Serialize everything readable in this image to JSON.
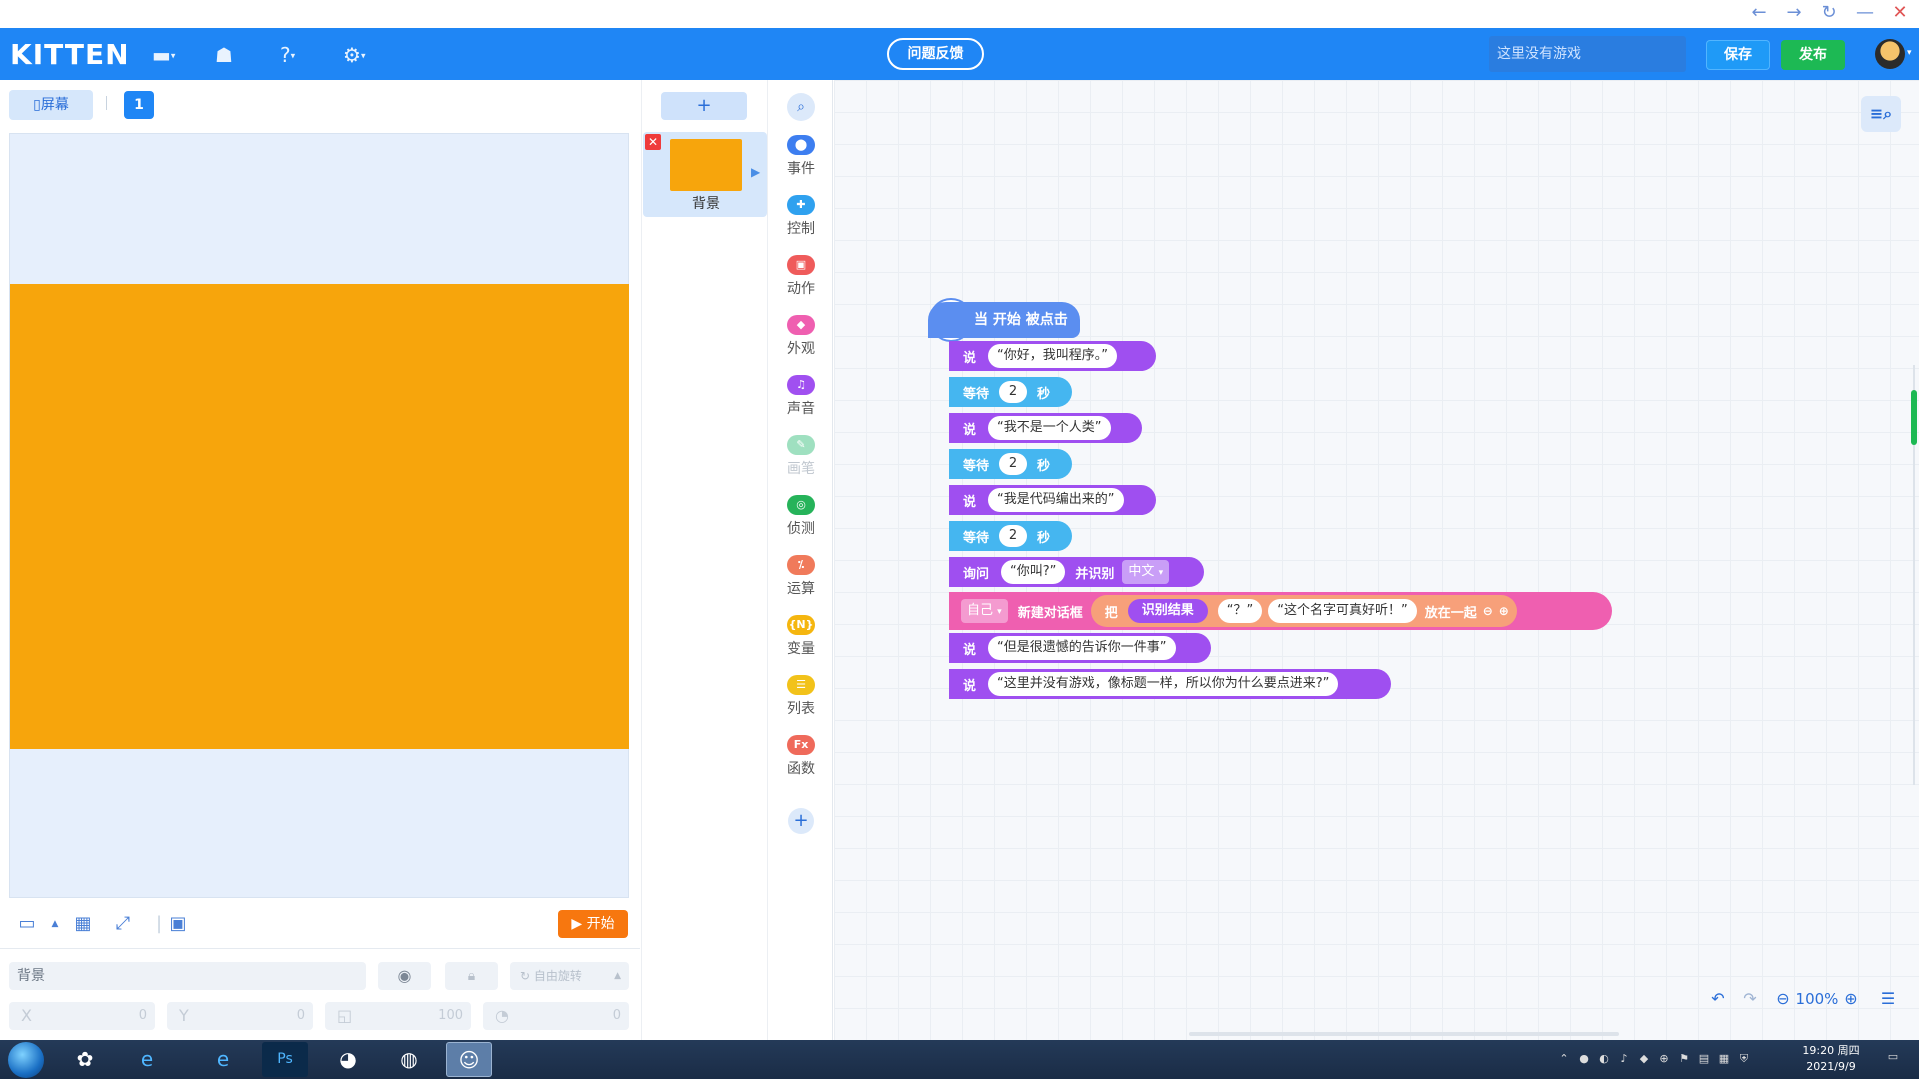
{
  "window": {
    "back_icon": "arrow-left-icon",
    "forward_icon": "arrow-right-icon",
    "refresh_icon": "refresh-icon",
    "min_icon": "minimize-icon",
    "close_icon": "close-icon"
  },
  "header": {
    "logo": "KITTEN",
    "feedback_label": "问题反馈",
    "game_title_placeholder": "这里没有游戏",
    "save_label": "保存",
    "publish_label": "发布",
    "accent": "#1f86f5"
  },
  "stage": {
    "screen_tab": "▯屏幕",
    "scene_number": "1",
    "start_label": "▶ 开始",
    "background_color": "#f7a50c"
  },
  "properties": {
    "name_value": "背景",
    "rotate_label": "自由旋转",
    "x_label": "X",
    "x_value": "0",
    "y_label": "Y",
    "y_value": "0",
    "size_value": "100",
    "direction_value": "0"
  },
  "sprites": {
    "add_label": "+",
    "items": [
      {
        "name": "背景",
        "color": "#f7a50c"
      }
    ]
  },
  "categories": [
    {
      "label": "事件",
      "icon": "event-icon",
      "color": "#3d7ef0"
    },
    {
      "label": "控制",
      "icon": "control-icon",
      "color": "#2fa1ef"
    },
    {
      "label": "动作",
      "icon": "motion-icon",
      "color": "#ef5b5b"
    },
    {
      "label": "外观",
      "icon": "looks-icon",
      "color": "#ef5fb0"
    },
    {
      "label": "声音",
      "icon": "sound-icon",
      "color": "#a050f0"
    },
    {
      "label": "画笔",
      "icon": "pen-icon",
      "color": "#9fe0c0"
    },
    {
      "label": "侦测",
      "icon": "sensing-icon",
      "color": "#26b35a"
    },
    {
      "label": "运算",
      "icon": "operator-icon",
      "color": "#f07a5b"
    },
    {
      "label": "变量",
      "icon": "variable-icon",
      "color": "#f5b60f"
    },
    {
      "label": "列表",
      "icon": "list-icon",
      "color": "#f2c21a"
    },
    {
      "label": "函数",
      "icon": "function-icon",
      "color": "#ef6a5b"
    }
  ],
  "script": {
    "hat": "当 开始 被点击",
    "say1_kw": "说",
    "say1": "“你好，我叫程序。”",
    "wait_kw": "等待",
    "wait_val": "2",
    "wait_unit": "秒",
    "say2": "“我不是一个人类”",
    "say3": "“我是代码编出来的”",
    "ask_kw": "询问",
    "ask_text": "“你叫?”",
    "ask_recognize": "并识别",
    "ask_lang": "中文",
    "self_label": "自己",
    "new_dialog": "新建对话框",
    "put_kw": "把",
    "recog_result": "识别结果",
    "q_mark": "“？”",
    "nice_name": "“这个名字可真好听！”",
    "join_kw": "放在一起",
    "say4": "“但是很遗憾的告诉你一件事”",
    "say5": "“这里并没有游戏，像标题一样，所以你为什么要点进来?”"
  },
  "zoom": {
    "level": "100%"
  },
  "taskbar": {
    "time": "19:20 周四",
    "date": "2021/9/9"
  }
}
